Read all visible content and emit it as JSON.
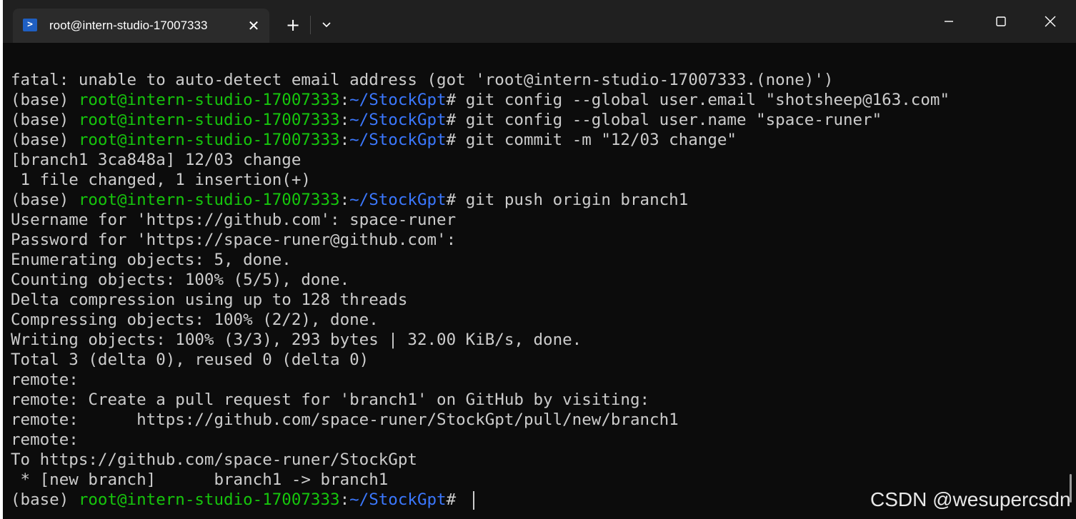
{
  "window": {
    "tab_title": "root@intern-studio-17007333",
    "tab_icon": "powershell-icon",
    "buttons": {
      "close_tab": "close-icon",
      "new_tab": "plus-icon",
      "dropdown": "chevron-down-icon",
      "minimize": "minimize-icon",
      "maximize": "maximize-icon",
      "close_window": "close-icon"
    }
  },
  "colors": {
    "background": "#0c0c0c",
    "titlebar": "#202020",
    "text": "#cccccc",
    "prompt_user": "#16c60c",
    "prompt_path": "#3b78ff"
  },
  "prompt": {
    "env": "(base) ",
    "user_host": "root@intern-studio-17007333",
    "colon": ":",
    "path": "~/StockGpt",
    "symbol": "# "
  },
  "terminal": {
    "lines": [
      "fatal: unable to auto-detect email address (got 'root@intern-studio-17007333.(none)')",
      "git config --global user.email \"shotsheep@163.com\"",
      "git config --global user.name \"space-runer\"",
      "git commit -m \"12/03 change\"",
      "[branch1 3ca848a] 12/03 change",
      " 1 file changed, 1 insertion(+)",
      "git push origin branch1",
      "Username for 'https://github.com': space-runer",
      "Password for 'https://space-runer@github.com':",
      "Enumerating objects: 5, done.",
      "Counting objects: 100% (5/5), done.",
      "Delta compression using up to 128 threads",
      "Compressing objects: 100% (2/2), done.",
      "Writing objects: 100% (3/3), 293 bytes | 32.00 KiB/s, done.",
      "Total 3 (delta 0), reused 0 (delta 0)",
      "remote:",
      "remote: Create a pull request for 'branch1' on GitHub by visiting:",
      "remote:      https://github.com/space-runer/StockGpt/pull/new/branch1",
      "remote:",
      "To https://github.com/space-runer/StockGpt",
      " * [new branch]      branch1 -> branch1",
      ""
    ]
  },
  "watermark": "CSDN @wesupercsdn"
}
